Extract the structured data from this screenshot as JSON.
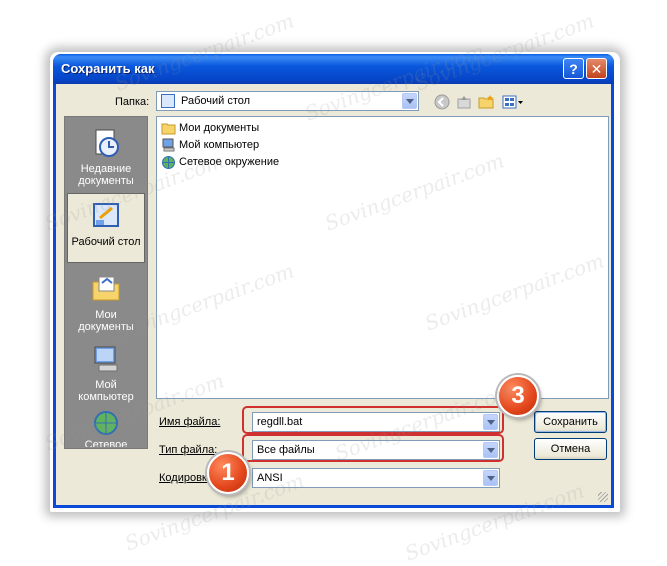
{
  "window": {
    "title": "Сохранить как"
  },
  "titlebar": {
    "help_glyph": "?",
    "close_glyph": "✕"
  },
  "toolbar": {
    "folder_label": "Папка:",
    "folder_value": "Рабочий стол"
  },
  "places": [
    {
      "label_line1": "Недавние",
      "label_line2": "документы",
      "icon": "recent-documents-icon"
    },
    {
      "label_line1": "Рабочий стол",
      "label_line2": "",
      "icon": "desktop-icon",
      "selected": true
    },
    {
      "label_line1": "Мои документы",
      "label_line2": "",
      "icon": "my-documents-icon"
    },
    {
      "label_line1": "Мой",
      "label_line2": "компьютер",
      "icon": "my-computer-icon"
    },
    {
      "label_line1": "Сетевое",
      "label_line2": "",
      "icon": "network-icon"
    }
  ],
  "files": [
    {
      "name": "Мои документы",
      "icon": "folder-icon"
    },
    {
      "name": "Мой компьютер",
      "icon": "computer-icon"
    },
    {
      "name": "Сетевое окружение",
      "icon": "network-places-icon"
    }
  ],
  "form": {
    "filename_label": "Имя файла:",
    "filename_value": "regdll.bat",
    "filetype_label": "Тип файла:",
    "filetype_value": "Все файлы",
    "encoding_label": "Кодировка:",
    "encoding_value": "ANSI"
  },
  "buttons": {
    "save": "Сохранить",
    "cancel": "Отмена"
  },
  "badges": {
    "one": "1",
    "three": "3"
  },
  "watermark": "Sovingcerpair.com",
  "colors": {
    "title_blue": "#0a4ad8",
    "highlight_red": "#d13030",
    "badge_orange": "#e3461c"
  }
}
